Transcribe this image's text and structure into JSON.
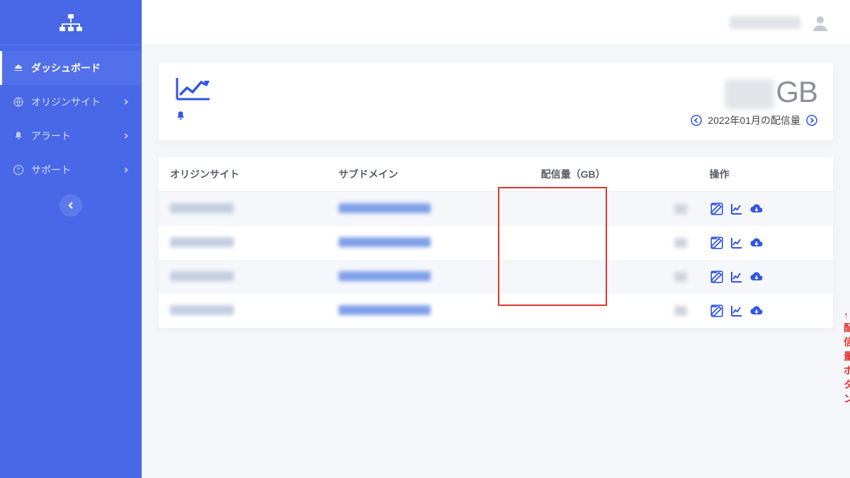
{
  "sidebar": {
    "items": [
      {
        "label": "ダッシュボード",
        "icon": "dashboard"
      },
      {
        "label": "オリジンサイト",
        "icon": "globe"
      },
      {
        "label": "アラート",
        "icon": "bell"
      },
      {
        "label": "サポート",
        "icon": "question"
      }
    ]
  },
  "summary": {
    "unit": "GB",
    "period_label": "2022年01月の配信量"
  },
  "table": {
    "headers": {
      "origin": "オリジンサイト",
      "subdomain": "サブドメイン",
      "volume": "配信量（GB）",
      "actions": "操作"
    },
    "row_count": 4
  },
  "annotation": {
    "chart_button": "↑ 配信量ボタン"
  }
}
